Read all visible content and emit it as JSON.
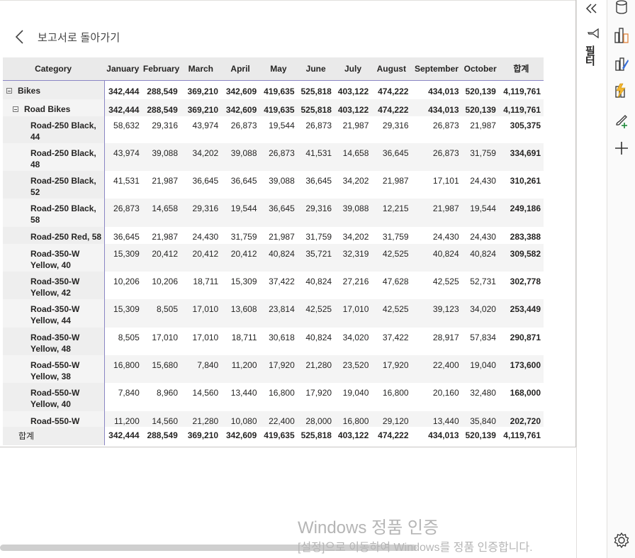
{
  "back_label": "보고서로 돌아가기",
  "table": {
    "headers": [
      "Category",
      "January",
      "February",
      "March",
      "April",
      "May",
      "June",
      "July",
      "August",
      "September",
      "October",
      "합계"
    ],
    "group1": {
      "label": "Bikes",
      "values": [
        "342,444",
        "288,549",
        "369,210",
        "342,609",
        "419,635",
        "525,818",
        "403,122",
        "474,222",
        "434,013",
        "520,139",
        "4,119,761"
      ]
    },
    "group2": {
      "label": "Road Bikes",
      "values": [
        "342,444",
        "288,549",
        "369,210",
        "342,609",
        "419,635",
        "525,818",
        "403,122",
        "474,222",
        "434,013",
        "520,139",
        "4,119,761"
      ]
    },
    "rows": [
      {
        "l1": "Road-250 Black,",
        "l2": "44",
        "v": [
          "58,632",
          "29,316",
          "43,974",
          "26,873",
          "19,544",
          "26,873",
          "21,987",
          "29,316",
          "26,873",
          "21,987",
          "305,375"
        ]
      },
      {
        "l1": "Road-250 Black,",
        "l2": "48",
        "v": [
          "43,974",
          "39,088",
          "34,202",
          "39,088",
          "26,873",
          "41,531",
          "14,658",
          "36,645",
          "26,873",
          "31,759",
          "334,691"
        ]
      },
      {
        "l1": "Road-250 Black,",
        "l2": "52",
        "v": [
          "41,531",
          "21,987",
          "36,645",
          "36,645",
          "39,088",
          "36,645",
          "34,202",
          "21,987",
          "17,101",
          "24,430",
          "310,261"
        ]
      },
      {
        "l1": "Road-250 Black,",
        "l2": "58",
        "v": [
          "26,873",
          "14,658",
          "29,316",
          "19,544",
          "36,645",
          "29,316",
          "39,088",
          "12,215",
          "21,987",
          "19,544",
          "249,186"
        ]
      },
      {
        "l1": "Road-250 Red, 58",
        "l2": "",
        "v": [
          "36,645",
          "21,987",
          "24,430",
          "31,759",
          "21,987",
          "31,759",
          "34,202",
          "31,759",
          "24,430",
          "24,430",
          "283,388"
        ]
      },
      {
        "l1": "Road-350-W",
        "l2": "Yellow, 40",
        "v": [
          "15,309",
          "20,412",
          "20,412",
          "20,412",
          "40,824",
          "35,721",
          "32,319",
          "42,525",
          "40,824",
          "40,824",
          "309,582"
        ]
      },
      {
        "l1": "Road-350-W",
        "l2": "Yellow, 42",
        "v": [
          "10,206",
          "10,206",
          "18,711",
          "15,309",
          "37,422",
          "40,824",
          "27,216",
          "47,628",
          "42,525",
          "52,731",
          "302,778"
        ]
      },
      {
        "l1": "Road-350-W",
        "l2": "Yellow, 44",
        "v": [
          "15,309",
          "8,505",
          "17,010",
          "13,608",
          "23,814",
          "42,525",
          "17,010",
          "42,525",
          "39,123",
          "34,020",
          "253,449"
        ]
      },
      {
        "l1": "Road-350-W",
        "l2": "Yellow, 48",
        "v": [
          "8,505",
          "17,010",
          "17,010",
          "18,711",
          "30,618",
          "40,824",
          "34,020",
          "37,422",
          "28,917",
          "57,834",
          "290,871"
        ]
      },
      {
        "l1": "Road-550-W",
        "l2": "Yellow, 38",
        "v": [
          "16,800",
          "15,680",
          "7,840",
          "11,200",
          "17,920",
          "21,280",
          "23,520",
          "17,920",
          "22,400",
          "19,040",
          "173,600"
        ]
      },
      {
        "l1": "Road-550-W",
        "l2": "Yellow, 40",
        "v": [
          "7,840",
          "8,960",
          "14,560",
          "13,440",
          "16,800",
          "17,920",
          "19,040",
          "16,800",
          "20,160",
          "32,480",
          "168,000"
        ]
      },
      {
        "l1": "Road-550-W",
        "l2": "",
        "v": [
          "11,200",
          "14,560",
          "21,280",
          "10,080",
          "22,400",
          "28,000",
          "16,800",
          "29,120",
          "13,440",
          "35,840",
          "202,720"
        ]
      }
    ],
    "total": {
      "label": "합계",
      "values": [
        "342,444",
        "288,549",
        "369,210",
        "342,609",
        "419,635",
        "525,818",
        "403,122",
        "474,222",
        "434,013",
        "520,139",
        "4,119,761"
      ]
    }
  },
  "right_pane": {
    "filters_label": "필터"
  },
  "watermark": {
    "line1": "Windows 정품 인증",
    "line2": "[설정]으로 이동하여 Windows를 정품 인증합니다."
  }
}
